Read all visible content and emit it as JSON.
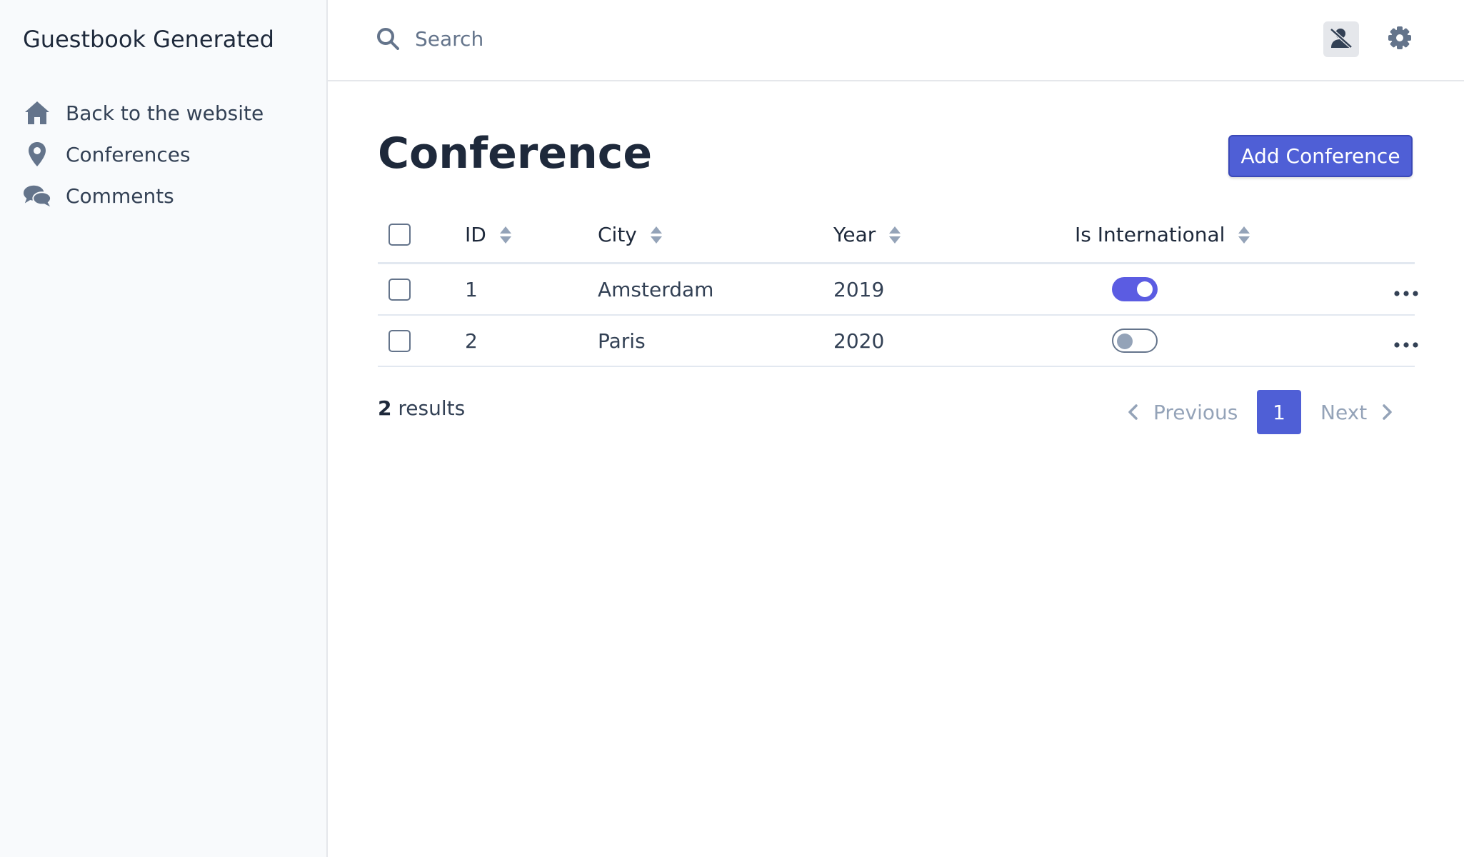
{
  "app": {
    "title": "Guestbook Generated"
  },
  "sidebar": {
    "items": [
      {
        "label": "Back to the website",
        "icon": "home-icon"
      },
      {
        "label": "Conferences",
        "icon": "map-marker-icon"
      },
      {
        "label": "Comments",
        "icon": "comments-icon"
      }
    ]
  },
  "topbar": {
    "search": {
      "placeholder": "Search",
      "value": ""
    },
    "user_icon": "user-slash-icon",
    "settings_icon": "gear-icon"
  },
  "main": {
    "title": "Conference",
    "add_button": "Add Conference",
    "columns": [
      "ID",
      "City",
      "Year",
      "Is International"
    ],
    "rows": [
      {
        "id": "1",
        "city": "Amsterdam",
        "year": "2019",
        "is_international": true
      },
      {
        "id": "2",
        "city": "Paris",
        "year": "2020",
        "is_international": false
      }
    ],
    "results_count": "2",
    "results_label": " results",
    "pagination": {
      "previous": "Previous",
      "current": "1",
      "next": "Next"
    }
  },
  "colors": {
    "accent": "#4f5fd6",
    "toggle_on": "#5b5ce2",
    "sidebar_bg": "#f8fafc",
    "text_dark": "#1e293b",
    "muted": "#94a3b8"
  }
}
